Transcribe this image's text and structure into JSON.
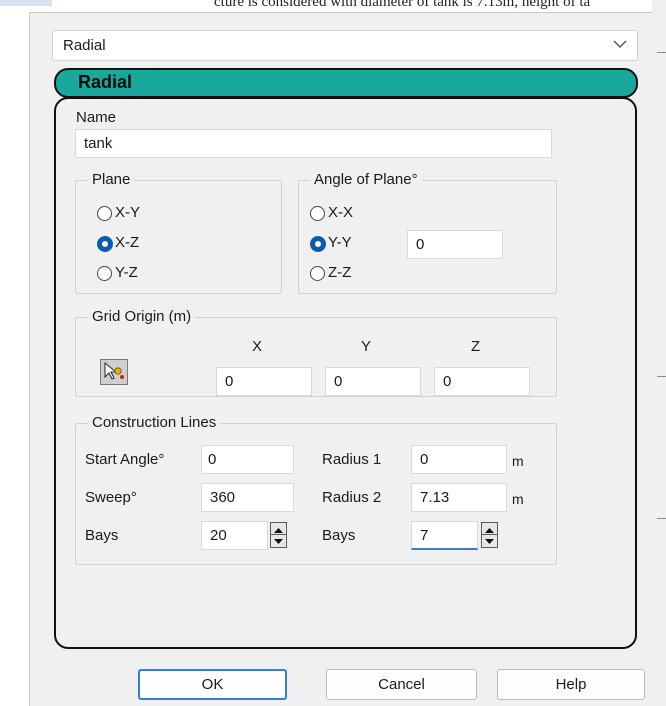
{
  "background_text": "cture is considered with diameter of tank is 7.13m, height of ta",
  "type_dropdown": {
    "value": "Radial"
  },
  "section_title": "Radial",
  "name": {
    "label": "Name",
    "value": "tank"
  },
  "plane": {
    "legend": "Plane",
    "options": [
      "X-Y",
      "X-Z",
      "Y-Z"
    ],
    "selected": "X-Z"
  },
  "angle_of_plane": {
    "legend": "Angle of Plane°",
    "options": [
      "X-X",
      "Y-Y",
      "Z-Z"
    ],
    "selected": "Y-Y",
    "value": "0"
  },
  "grid_origin": {
    "legend": "Grid Origin (m)",
    "headers": [
      "X",
      "Y",
      "Z"
    ],
    "values": [
      "0",
      "0",
      "0"
    ],
    "picker_icon": "pick-point-icon"
  },
  "construction_lines": {
    "legend": "Construction Lines",
    "start_angle_label": "Start Angle°",
    "start_angle_value": "0",
    "sweep_label": "Sweep°",
    "sweep_value": "360",
    "bays_left_label": "Bays",
    "bays_left_value": "20",
    "radius1_label": "Radius 1",
    "radius1_value": "0",
    "radius1_unit": "m",
    "radius2_label": "Radius 2",
    "radius2_value": "7.13",
    "radius2_unit": "m",
    "bays_right_label": "Bays",
    "bays_right_value": "7"
  },
  "buttons": {
    "ok": "OK",
    "cancel": "Cancel",
    "help": "Help"
  },
  "colors": {
    "accent": "#1aa89c",
    "radio_selected": "#0b5cad",
    "focus": "#3b7ed1"
  }
}
